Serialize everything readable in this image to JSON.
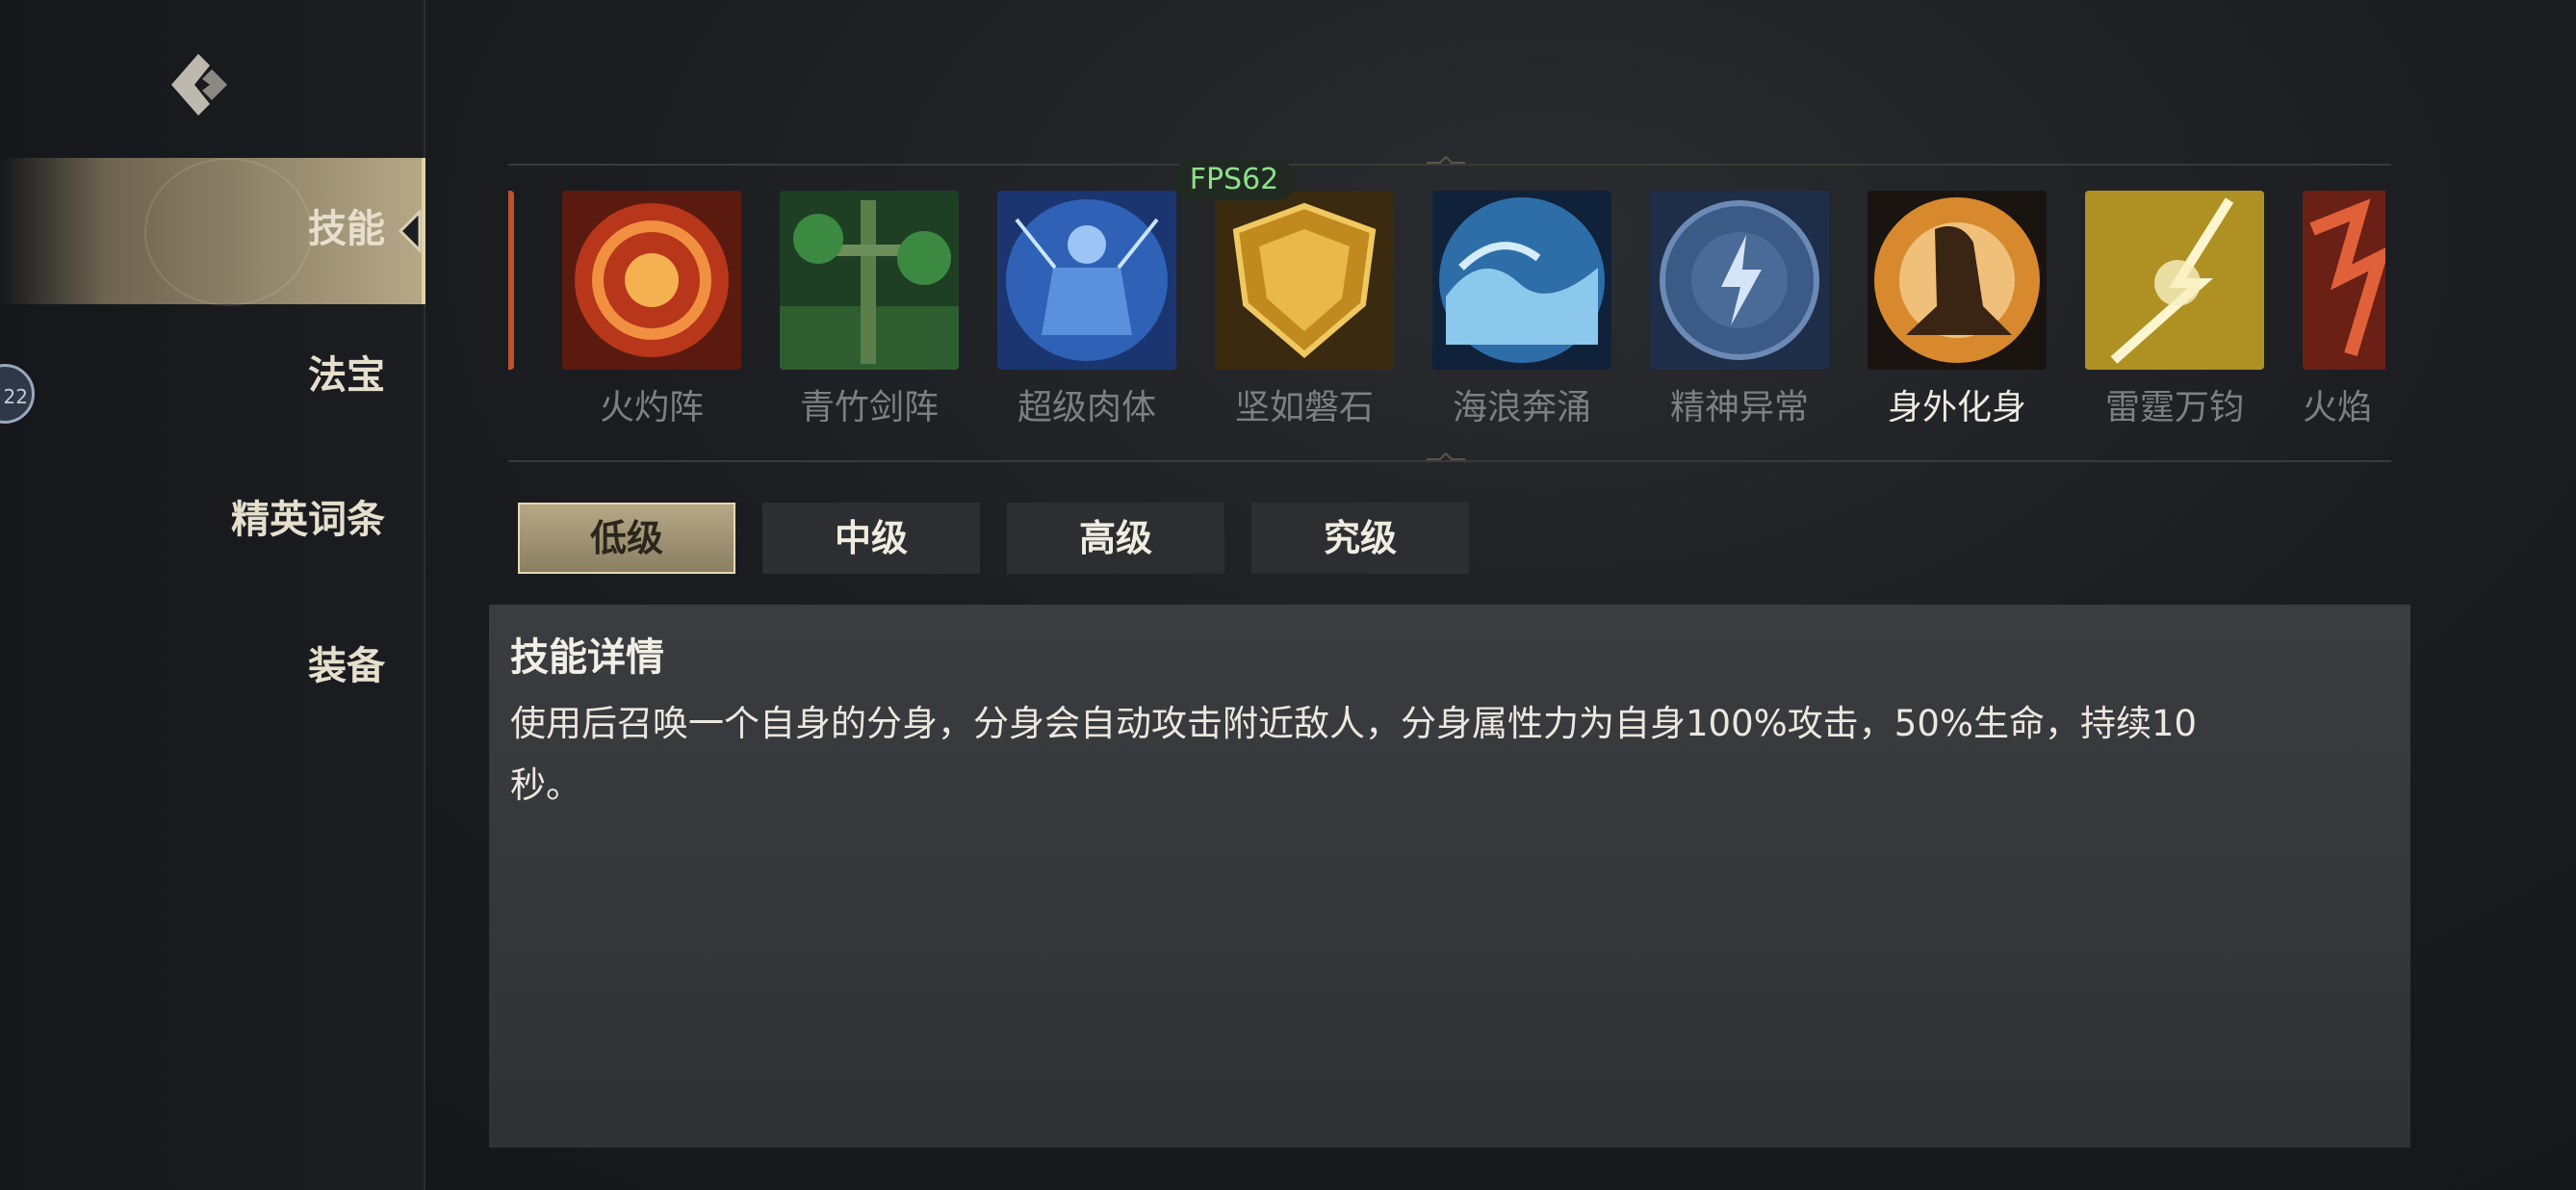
{
  "sidebar": {
    "items": [
      {
        "label": "技能",
        "active": true
      },
      {
        "label": "法宝"
      },
      {
        "label": "精英词条"
      },
      {
        "label": "装备"
      }
    ],
    "avatar_text": "22"
  },
  "fps": "FPS62",
  "skills": [
    {
      "label": "",
      "icon": "fire-partial-icon",
      "color": "#c0502a"
    },
    {
      "label": "火灼阵",
      "icon": "fire-ring-icon",
      "color": "#d2471f"
    },
    {
      "label": "青竹剑阵",
      "icon": "bamboo-sword-icon",
      "color": "#3a7a3c"
    },
    {
      "label": "超级肉体",
      "icon": "blue-giant-icon",
      "color": "#2f62b6"
    },
    {
      "label": "坚如磐石",
      "icon": "golden-shield-icon",
      "color": "#c08a1e"
    },
    {
      "label": "海浪奔涌",
      "icon": "wave-icon",
      "color": "#2d6ea8"
    },
    {
      "label": "精神异常",
      "icon": "lightning-orb-icon",
      "color": "#3b5a86"
    },
    {
      "label": "身外化身",
      "icon": "clone-warrior-icon",
      "color": "#d8892e",
      "active": true
    },
    {
      "label": "雷霆万钧",
      "icon": "thunder-bolt-icon",
      "color": "#c8a52c"
    },
    {
      "label": "火焰",
      "icon": "flame-partial-icon",
      "color": "#b8442a"
    }
  ],
  "tabs": [
    {
      "label": "低级",
      "active": true
    },
    {
      "label": "中级"
    },
    {
      "label": "高级"
    },
    {
      "label": "究级"
    }
  ],
  "detail": {
    "title": "技能详情",
    "text_line1": "使用后召唤一个自身的分身，分身会自动攻击附近敌人，分身属性力为自身100%攻击，50%生命，持续10",
    "text_line2": "秒。"
  }
}
